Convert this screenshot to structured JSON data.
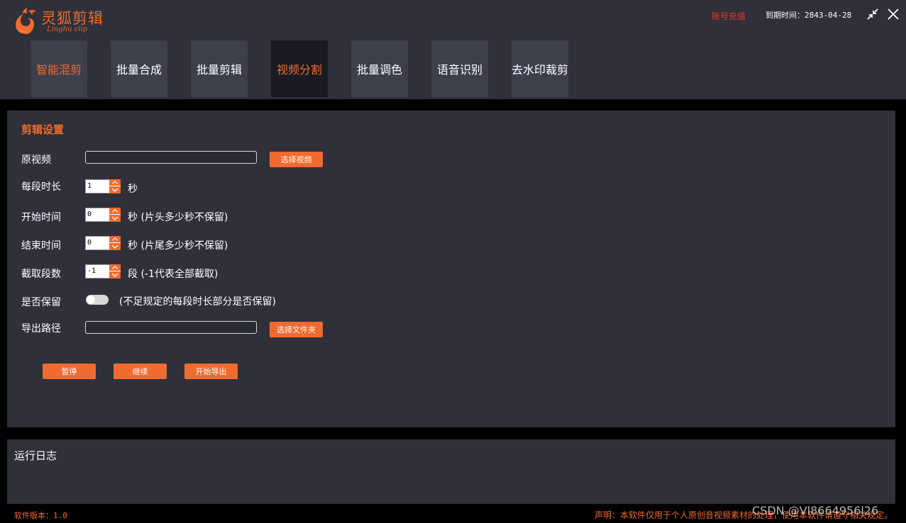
{
  "app": {
    "logo_text": "灵狐剪辑",
    "logo_subtitle": "Linghu clip",
    "recharge_link": "账号充值",
    "expiry_label": "到期时间：",
    "expiry_value": "2843-04-28"
  },
  "tabs": [
    {
      "label": "智能混剪"
    },
    {
      "label": "批量合成"
    },
    {
      "label": "批量剪辑"
    },
    {
      "label": "视频分割"
    },
    {
      "label": "批量调色"
    },
    {
      "label": "语音识别"
    },
    {
      "label": "去水印裁剪"
    }
  ],
  "active_tab": "视频分割",
  "settings": {
    "title": "剪辑设置",
    "source_video": {
      "label": "原视频",
      "value": "",
      "button": "选择视频"
    },
    "segment_duration": {
      "label": "每段时长",
      "value": "1",
      "unit": "秒"
    },
    "start_time": {
      "label": "开始时间",
      "value": "0",
      "unit": "秒 (片头多少秒不保留)"
    },
    "end_time": {
      "label": "结束时间",
      "value": "0",
      "unit": "秒 (片尾多少秒不保留)"
    },
    "segment_count": {
      "label": "截取段数",
      "value": "-1",
      "unit": "段 (-1代表全部截取)"
    },
    "keep_remainder": {
      "label": "是否保留",
      "enabled": false,
      "hint": "(不足规定的每段时长部分是否保留)"
    },
    "export_path": {
      "label": "导出路径",
      "value": "",
      "button": "选择文件夹"
    },
    "actions": {
      "pause": "暂停",
      "resume": "继续",
      "start_export": "开始导出"
    }
  },
  "log": {
    "title": "运行日志"
  },
  "footer": {
    "version_label": "软件版本：",
    "version_value": "1.0",
    "disclaimer": "声明：本软件仅用于个人原创音视频素材的处理，使用本软件请遵守相关规定。",
    "watermark": "CSDN @Vl8664956l26"
  },
  "colors": {
    "accent": "#f06b2f",
    "panel_bg": "#2f3039",
    "tab_bg": "#3e3f4d",
    "tab_active_bg": "#191a23",
    "recharge": "#e53b2d"
  }
}
